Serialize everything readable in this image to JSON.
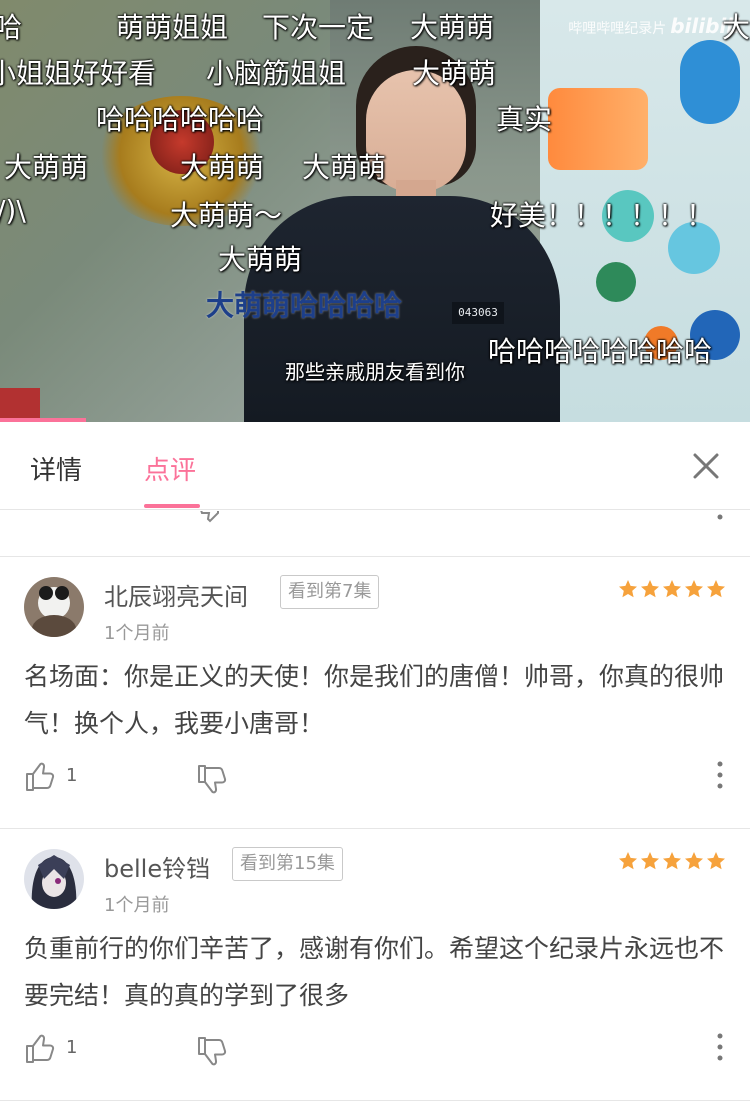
{
  "video": {
    "watermark_text": "哔哩哔哩纪录片",
    "watermark_logo": "bilibili",
    "subtitle": "那些亲戚朋友看到你",
    "badge_number": "043063",
    "progress_fraction": 0.115,
    "danmaku": [
      "哈",
      "萌萌姐姐",
      "下次一定",
      "大萌萌",
      "大",
      "小姐姐好好看",
      "小脑筋姐姐",
      "大萌萌",
      "哈哈哈哈哈哈",
      "真实",
      "大萌萌",
      "大萌萌",
      "大萌萌",
      "/)\\",
      "大萌萌～",
      "好美！！！！！！",
      "大萌萌",
      "大萌萌哈哈哈哈",
      "哈哈哈哈哈哈哈哈"
    ]
  },
  "tabs": [
    {
      "label": "详情",
      "active": false
    },
    {
      "label": "点评",
      "active": true
    }
  ],
  "accent_color": "#fb7299",
  "star_color": "#f6a23c",
  "comments": [
    {
      "username": "北辰翊亮天间",
      "episode_badge": "看到第7集",
      "time": "1个月前",
      "rating": 5,
      "content": "名场面：你是正义的天使！你是我们的唐僧！帅哥，你真的很帅气！换个人，我要小唐哥！",
      "likes": "1"
    },
    {
      "username": "belle铃铛",
      "episode_badge": "看到第15集",
      "time": "1个月前",
      "rating": 5,
      "content": "负重前行的你们辛苦了，感谢有你们。希望这个纪录片永远也不要完结！真的真的学到了很多",
      "likes": "1"
    }
  ]
}
